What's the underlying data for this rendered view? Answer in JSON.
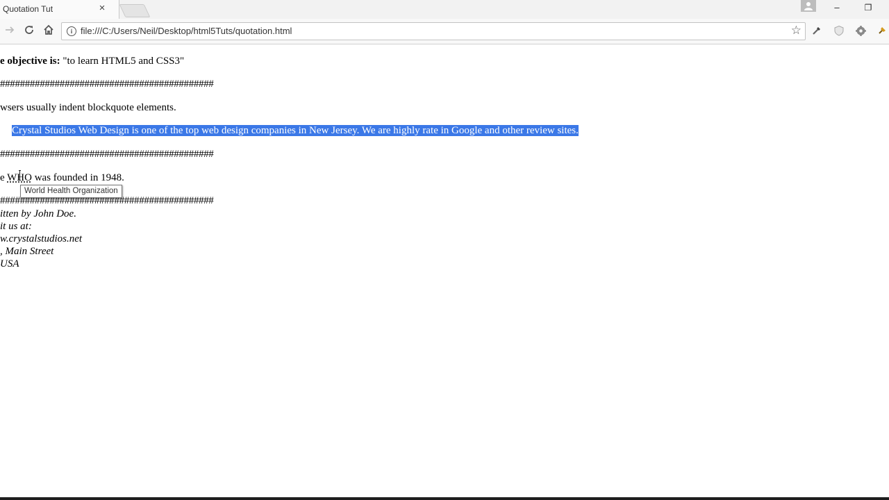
{
  "browser": {
    "tab_title": "Quotation Tut",
    "close_glyph": "×",
    "url": "file:///C:/Users/Neil/Desktop/html5Tuts/quotation.html"
  },
  "window_controls": {
    "minimize": "–",
    "restore": "❐",
    "icons": [
      "minimize-icon",
      "restore-icon",
      "profile-icon"
    ]
  },
  "toolbar": {
    "icons": [
      "back-icon",
      "forward-icon",
      "reload-icon",
      "home-icon",
      "info-icon",
      "star-icon"
    ]
  },
  "extensions": [
    "eyedropper-icon",
    "shield-icon",
    "settings-gear-icon",
    "pin-icon"
  ],
  "page": {
    "objective_label": "e objective is:",
    "objective_quote": " \"to learn HTML5 and CSS3\"",
    "separator": "###########################################",
    "browsers_text": "wsers usually indent blockquote elements.",
    "blockquote": "Crystal Studios Web Design is one of the top web design companies in New Jersey. We are highly rate in Google and other review sites.",
    "abbr_prefix": "e ",
    "abbr_text": "WHO",
    "abbr_suffix": " was founded in 1948.",
    "tooltip": "World Health Organization",
    "address": [
      "itten by John Doe.",
      "it us at:",
      "w.crystalstudios.net",
      ", Main Street",
      " USA"
    ]
  }
}
